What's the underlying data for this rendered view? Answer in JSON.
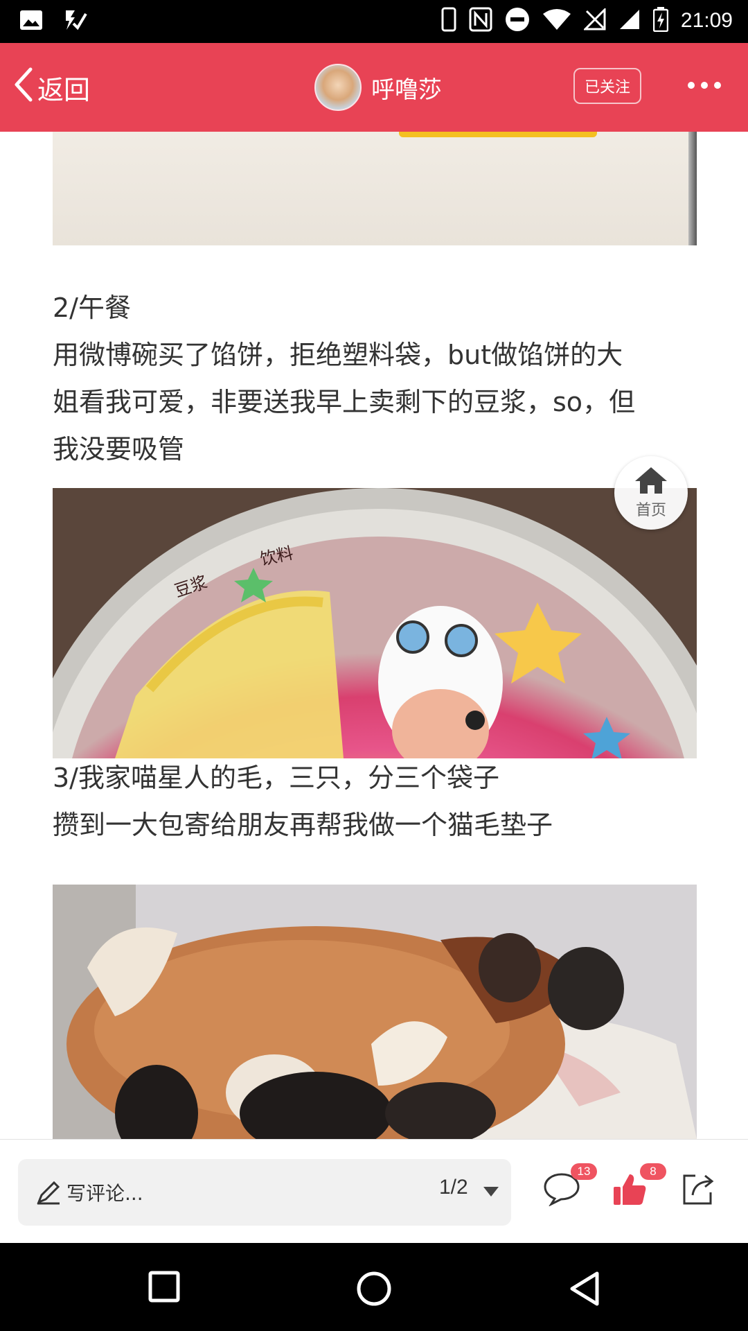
{
  "status_bar": {
    "time": "21:09"
  },
  "header": {
    "back_label": "返回",
    "username": "呼噜莎",
    "follow_label": "已关注"
  },
  "content": {
    "section2": {
      "title": "2/午餐",
      "lines": [
        "用微博碗买了馅饼，拒绝塑料袋，but做馅饼的大",
        "姐看我可爱，非要送我早上卖剩下的豆浆，so，但",
        "我没要吸管"
      ]
    },
    "cup_lid_text": [
      "饮料",
      "豆浆"
    ],
    "section3": {
      "lines": [
        "3/我家喵星人的毛，三只，分三个袋子",
        "攒到一大包寄给朋友再帮我做一个猫毛垫子"
      ]
    },
    "home_button_label": "首页"
  },
  "bottom_bar": {
    "comment_placeholder": "写评论...",
    "page_indicator": "1/2",
    "comment_count": "13",
    "like_count": "8"
  },
  "colors": {
    "brand": "#e84355",
    "badge": "#ef5461",
    "like": "#e84355"
  }
}
